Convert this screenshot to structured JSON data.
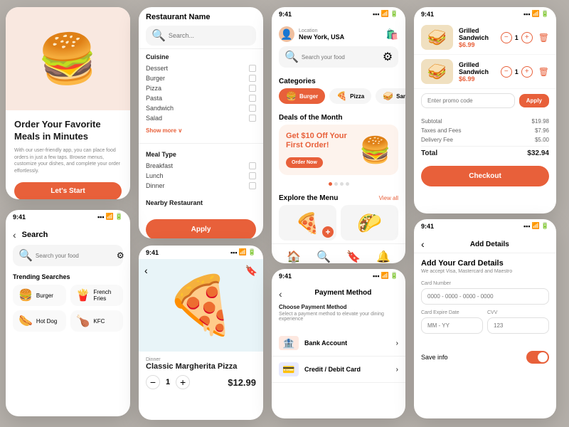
{
  "screens": {
    "welcome": {
      "title": "Order Your Favorite Meals in Minutes",
      "desc": "With our user-friendly app, you can place food orders in just a few taps. Browse menus, customize your dishes, and complete your order effortlessly.",
      "cta": "Let's Start",
      "hero_emoji": "🍔"
    },
    "filter": {
      "header": "Restaurant Name",
      "search_placeholder": "Search...",
      "cuisine_title": "Cuisine",
      "cuisine_items": [
        "Dessert",
        "Burger",
        "Pizza",
        "Pasta",
        "Sandwich",
        "Salad"
      ],
      "show_more": "Show more",
      "meal_type_title": "Meal Type",
      "meal_items": [
        "Breakfast",
        "Lunch",
        "Dinner"
      ],
      "nearby_title": "Nearby Restaurant",
      "apply_btn": "Apply"
    },
    "home": {
      "time": "9:41",
      "location_label": "Location",
      "location": "New York, USA",
      "search_placeholder": "Search your food",
      "categories_title": "Categories",
      "categories": [
        {
          "name": "Burger",
          "emoji": "🍔",
          "active": true
        },
        {
          "name": "Pizza",
          "emoji": "🍕",
          "active": false
        },
        {
          "name": "Sandwich",
          "emoji": "🥪",
          "active": false
        }
      ],
      "deals_title": "Deals of the Month",
      "deal_highlight": "Get $10 Off Your First Order!",
      "deal_btn": "Order Now",
      "deal_emoji": "🍔",
      "explore_title": "Explore the Menu",
      "view_all": "View all",
      "menu_items": [
        "🍕",
        "🌮"
      ]
    },
    "cart": {
      "time": "9:41",
      "items": [
        {
          "name": "Grilled Sandwich",
          "price": "$6.99",
          "qty": "1",
          "emoji": "🥪"
        },
        {
          "name": "Grilled Sandwich",
          "price": "$6.99",
          "qty": "1",
          "emoji": "🥪"
        }
      ],
      "promo_placeholder": "Enter promo code",
      "apply_btn": "Apply",
      "subtotal_label": "Subtotal",
      "subtotal_val": "$19.98",
      "taxes_label": "Taxes and Fees",
      "taxes_val": "$7.96",
      "delivery_label": "Delivery Fee",
      "delivery_val": "$5.00",
      "total_label": "Total",
      "total_val": "$32.94",
      "checkout_btn": "Checkout"
    },
    "search": {
      "time": "9:41",
      "back_title": "Search",
      "search_placeholder": "Search your food",
      "trending_title": "Trending Searches",
      "trending": [
        {
          "name": "Burger",
          "emoji": "🍔"
        },
        {
          "name": "French Fries",
          "emoji": "🍟"
        },
        {
          "name": "Hot Dog",
          "emoji": "🌭"
        },
        {
          "name": "KFC",
          "emoji": "🍗"
        }
      ]
    },
    "pizza": {
      "time": "9:41",
      "emoji": "🍕",
      "category": "Dinner",
      "name": "Classic Margherita Pizza",
      "price": "$12.99",
      "qty": "1"
    },
    "payment": {
      "time": "9:41",
      "header": "Payment Method",
      "title": "Choose Payment Method",
      "desc": "Select a payment method to elevate your dining experience",
      "options": [
        {
          "name": "Bank Account",
          "emoji": "🏦",
          "type": "bank"
        },
        {
          "name": "Credit / Debit Card",
          "emoji": "💳",
          "type": "card"
        }
      ]
    },
    "add_card": {
      "time": "9:41",
      "header_title": "Add Details",
      "form_title": "Add Your Card Details",
      "form_desc": "We accept Visa, Mastercard and Maestro",
      "card_number_label": "Card Number",
      "card_number_placeholder": "0000 - 0000 - 0000 - 0000",
      "expire_label": "Card Expire Date",
      "expire_placeholder": "MM - YY",
      "cvv_label": "CVV",
      "cvv_placeholder": "123",
      "save_label": "Save info"
    }
  },
  "colors": {
    "accent": "#e8603a",
    "light_bg": "#f5f5f5",
    "text_dark": "#1a1a1a",
    "text_muted": "#888888"
  }
}
